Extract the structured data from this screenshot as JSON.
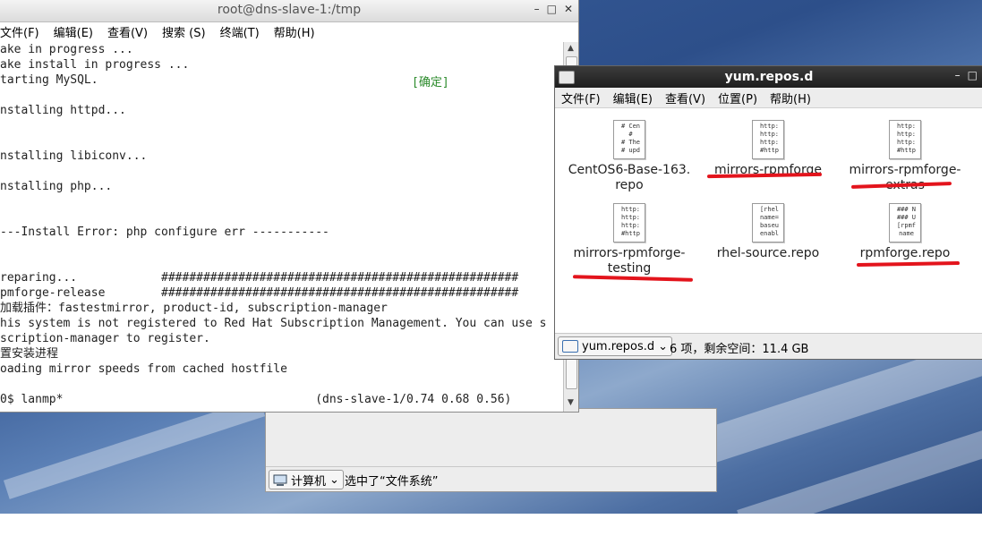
{
  "terminal": {
    "title": "root@dns-slave-1:/tmp",
    "menu": [
      "文件(F)",
      "编辑(E)",
      "查看(V)",
      "搜索 (S)",
      "终端(T)",
      "帮助(H)"
    ],
    "lines": [
      "ake in progress ...",
      "ake install in progress ...",
      "tarting MySQL.",
      "",
      "nstalling httpd...",
      "",
      "",
      "nstalling libiconv...",
      "",
      "nstalling php...",
      "",
      "",
      "---Install Error: php configure err -----------",
      "",
      "",
      "reparing...            ###################################################",
      "pmforge-release        ###################################################",
      "加载插件：fastestmirror, product-id, subscription-manager",
      "his system is not registered to Red Hat Subscription Management. You can use s",
      "scription-manager to register.",
      "置安装进程",
      "oading mirror speeds from cached hostfile",
      "",
      "0$ lanmp*                                    (dns-slave-1/0.74 0.68 0.56)"
    ],
    "ok_label": "[确定]"
  },
  "back_window": {
    "location": "计算机",
    "status": "选中了“文件系统”"
  },
  "file_manager": {
    "title": "yum.repos.d",
    "menu": [
      "文件(F)",
      "编辑(E)",
      "查看(V)",
      "位置(P)",
      "帮助(H)"
    ],
    "files": [
      {
        "name_line1": "CentOS6-Base-163.",
        "name_line2": "repo",
        "preview": "# Cen\n#\n# The\n# upd"
      },
      {
        "name_line1": "mirrors-rpmforge",
        "name_line2": "",
        "preview": "http:\nhttp:\nhttp:\n#http"
      },
      {
        "name_line1": "mirrors-rpmforge-",
        "name_line2": "extras",
        "preview": "http:\nhttp:\nhttp:\n#http"
      },
      {
        "name_line1": "mirrors-rpmforge-",
        "name_line2": "testing",
        "preview": "http:\nhttp:\nhttp:\n#http"
      },
      {
        "name_line1": "rhel-source.repo",
        "name_line2": "",
        "preview": "[rhel\nname=\nbaseu\nenabl"
      },
      {
        "name_line1": "rpmforge.repo",
        "name_line2": "",
        "preview": "### N\n### U\n[rpmf\nname"
      }
    ],
    "location": "yum.repos.d",
    "status": "6 项，剩余空间：11.4 GB"
  },
  "colors": {
    "annotation": "#e3141c",
    "ok": "#2a8a2a"
  }
}
